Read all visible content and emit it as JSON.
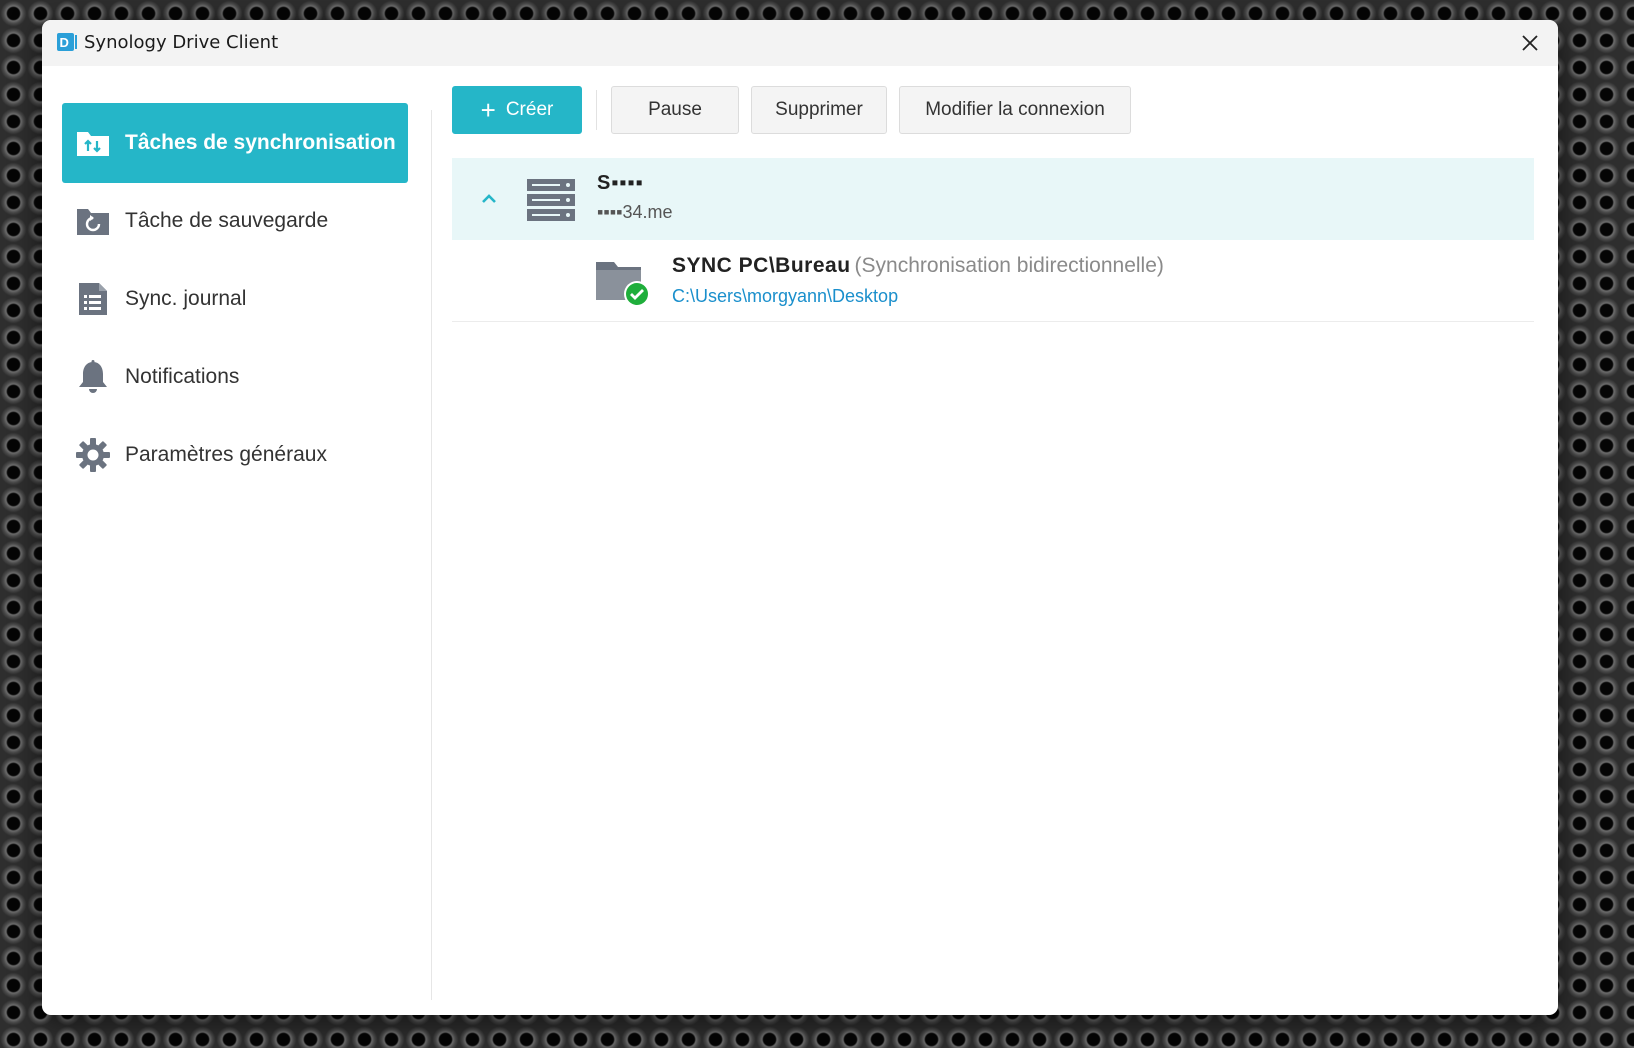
{
  "window": {
    "title": "Synology Drive Client"
  },
  "sidebar": {
    "items": [
      {
        "label": "Tâches de synchronisation",
        "icon": "sync-folder-icon",
        "active": true
      },
      {
        "label": "Tâche de sauvegarde",
        "icon": "backup-folder-icon",
        "active": false
      },
      {
        "label": "Sync. journal",
        "icon": "log-list-icon",
        "active": false
      },
      {
        "label": "Notifications",
        "icon": "bell-icon",
        "active": false
      },
      {
        "label": "Paramètres généraux",
        "icon": "gear-icon",
        "active": false
      }
    ]
  },
  "toolbar": {
    "create_label": "Créer",
    "pause_label": "Pause",
    "delete_label": "Supprimer",
    "modify_connection_label": "Modifier la connexion"
  },
  "server": {
    "name": "S▪▪▪▪",
    "host": "▪▪▪▪34.me",
    "expanded": true
  },
  "tasks": [
    {
      "name": "SYNC PC\\Bureau",
      "mode": "(Synchronisation bidirectionnelle)",
      "path": "C:\\Users\\morgyann\\Desktop",
      "status": "synced"
    }
  ],
  "colors": {
    "accent": "#25b6c8",
    "link": "#1a8fcc",
    "success": "#1fae3b",
    "selected_row": "#e8f7f8"
  }
}
